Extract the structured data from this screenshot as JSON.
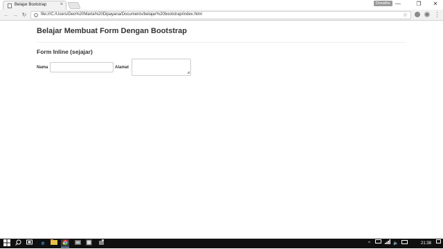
{
  "browser": {
    "tab_title": "Belajar Bootstrap",
    "tab_close": "×",
    "profile_label": "Desatha",
    "url": "file:///C:/Users/Deo%20Marta%20Dipayana/Documents/belajar%20bootstrap/index.html",
    "nav": {
      "back": "←",
      "forward": "→",
      "reload": "↻"
    },
    "window_controls": {
      "minimize": "—",
      "maximize": "❐",
      "close": "✕"
    },
    "star": "☆",
    "menu": "⋮"
  },
  "page": {
    "title": "Belajar Membuat Form Dengan Bootstrap",
    "section_title": "Form Inline (sejajar)",
    "form": {
      "nama_label": "Nama",
      "nama_value": "",
      "alamat_label": "Alamat",
      "alamat_value": ""
    }
  },
  "taskbar": {
    "clock": "21:38",
    "tray_caret": "^",
    "tray_sound": "🔈"
  }
}
